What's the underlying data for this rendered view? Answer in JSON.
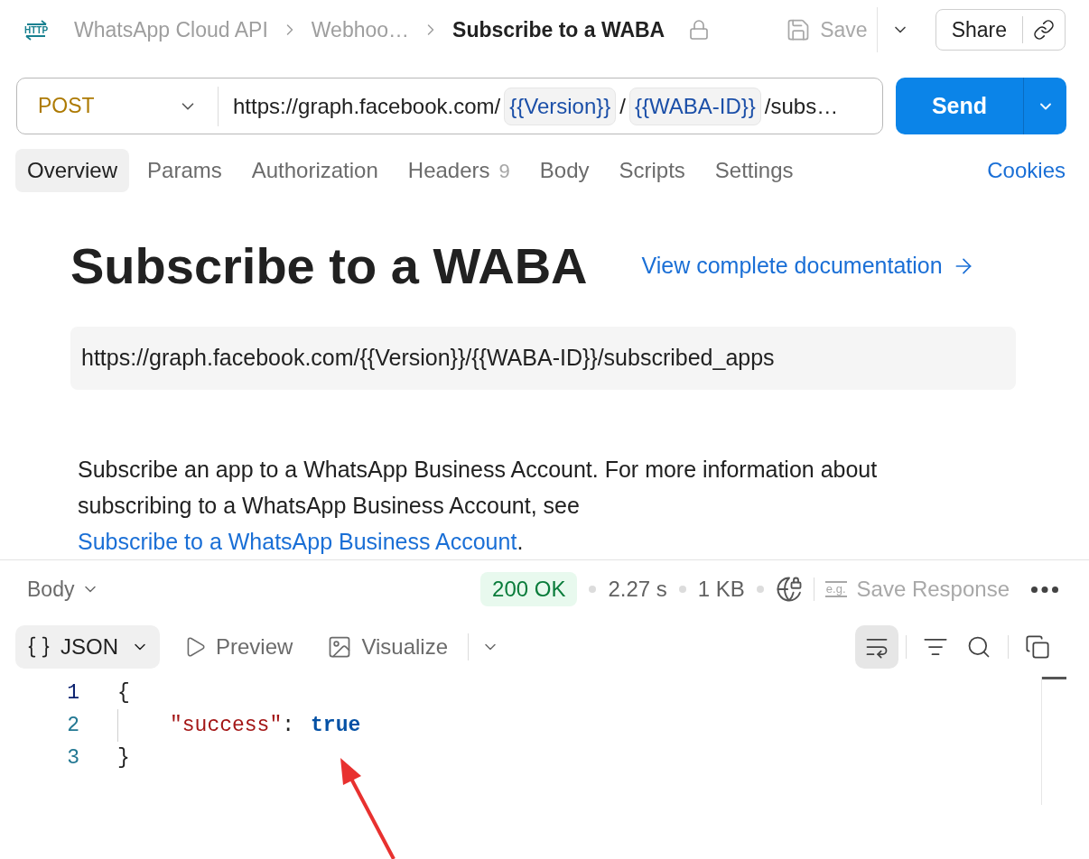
{
  "header": {
    "icon_label": "HTTP",
    "breadcrumbs": [
      "WhatsApp Cloud API",
      "Webhoo…"
    ],
    "title": "Subscribe to a WABA",
    "locked": true,
    "save": {
      "label": "Save",
      "disabled": true
    },
    "share": {
      "label": "Share"
    }
  },
  "request": {
    "method": "POST",
    "url": [
      {
        "kind": "text",
        "text": "https://graph.facebook.com/"
      },
      {
        "kind": "variable",
        "text": "{{Version}}"
      },
      {
        "kind": "text",
        "text": "/"
      },
      {
        "kind": "variable",
        "text": "{{WABA-ID}}"
      },
      {
        "kind": "text",
        "text": "/subs…"
      }
    ],
    "send": "Send"
  },
  "tabs": [
    {
      "label": "Overview",
      "selected": true
    },
    {
      "label": "Params",
      "selected": false
    },
    {
      "label": "Authorization",
      "selected": false
    },
    {
      "label": "Headers",
      "count": "9",
      "selected": false
    },
    {
      "label": "Body",
      "selected": false
    },
    {
      "label": "Scripts",
      "selected": false
    },
    {
      "label": "Settings",
      "selected": false
    }
  ],
  "cookies": "Cookies",
  "overview": {
    "title": "Subscribe to a WABA",
    "docs_link": "View complete documentation",
    "endpoint": "https://graph.facebook.com/{{Version}}/{{WABA-ID}}/subscribed_apps",
    "description": {
      "text": "Subscribe an app to a WhatsApp Business Account. For more information about subscribing to a WhatsApp Business Account, see",
      "link": "Subscribe to a WhatsApp Business Account",
      "end": "."
    }
  },
  "response": {
    "section": "Body",
    "status": "200 OK",
    "time": "2.27 s",
    "size": "1 KB",
    "save_response": {
      "icon_text": "e.g.",
      "label": "Save Response",
      "disabled": true
    },
    "views": [
      {
        "kind": "format",
        "label": "JSON",
        "selected": true
      },
      {
        "kind": "preview",
        "label": "Preview",
        "selected": false
      },
      {
        "kind": "visualize",
        "label": "Visualize",
        "selected": false
      }
    ],
    "tool_groups": [
      [
        {
          "kind": "wrap",
          "on": true
        }
      ],
      [
        {
          "kind": "filter",
          "on": false
        },
        {
          "kind": "search",
          "on": false
        }
      ],
      [
        {
          "kind": "copy",
          "on": false
        }
      ]
    ],
    "code": {
      "open": {
        "number": "1",
        "text": "{",
        "active": true
      },
      "members": [
        {
          "number": "2",
          "key": "\"success\"",
          "colon": ":",
          "value": "true",
          "active": false
        }
      ],
      "close": {
        "number": "3",
        "text": "}",
        "active": false
      }
    }
  }
}
